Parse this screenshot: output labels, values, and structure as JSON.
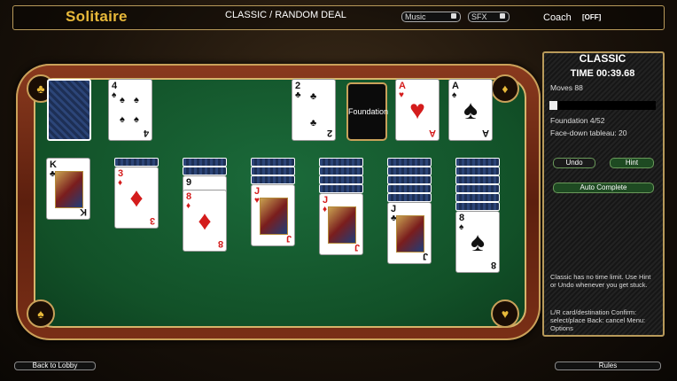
{
  "header": {
    "app_title": "Solitaire",
    "mode_label": "CLASSIC / RANDOM DEAL",
    "music_label": "Music",
    "sfx_label": "SFX",
    "coach_label": "Coach",
    "coach_state": "[OFF]"
  },
  "stock": {
    "label": ""
  },
  "waste": {
    "rank": "4",
    "suit": "♠"
  },
  "foundation_slots": [
    {
      "rank": "2",
      "suit": "♣",
      "color": "blk"
    },
    {
      "label": "Foundation"
    },
    {
      "rank": "A",
      "suit": "♥",
      "color": "red"
    },
    {
      "rank": "A",
      "suit": "♠",
      "color": "blk"
    }
  ],
  "tableau": [
    {
      "facedown": 0,
      "top": {
        "rank": "K",
        "suit": "♣",
        "color": "blk"
      }
    },
    {
      "facedown": 1,
      "top": {
        "rank": "3",
        "suit": "♦",
        "color": "red"
      }
    },
    {
      "facedown": 2,
      "top": {
        "rank": "8",
        "suit": "♦",
        "color": "red"
      }
    },
    {
      "facedown": 3,
      "top": {
        "rank": "J",
        "suit": "♥",
        "color": "red"
      }
    },
    {
      "facedown": 4,
      "top": {
        "rank": "J",
        "suit": "♦",
        "color": "red"
      }
    },
    {
      "facedown": 5,
      "top": {
        "rank": "J",
        "suit": "♣",
        "color": "blk"
      }
    },
    {
      "facedown": 6,
      "top": {
        "rank": "8",
        "suit": "♠",
        "color": "blk"
      }
    }
  ],
  "column3_second": {
    "rank": "9",
    "suit": "♠"
  },
  "panel": {
    "mode": "CLASSIC",
    "time": "TIME 00:39.68",
    "moves": "Moves 88",
    "progress": 0.077,
    "foundation": "Foundation 4/52",
    "facedown": "Face-down tableau: 20",
    "undo_label": "Undo",
    "hint_label": "Hint",
    "auto_label": "Auto Complete",
    "hint_text": "Classic has no time limit. Use Hint or Undo whenever you get stuck.",
    "controls_text": "L/R  card/destination  Confirm: select/place  Back: cancel  Menu: Options"
  },
  "footer": {
    "back_label": "Back to Lobby",
    "rules_label": "Rules"
  }
}
